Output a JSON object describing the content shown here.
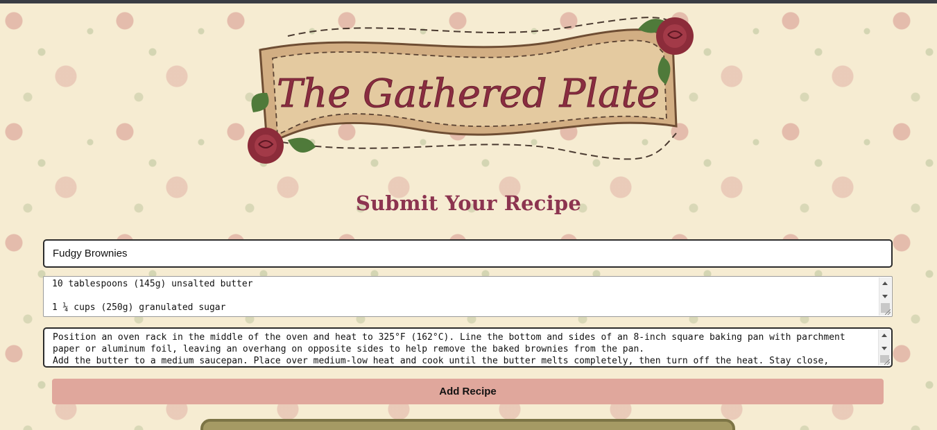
{
  "header": {
    "logo_text": "The Gathered Plate"
  },
  "page_title": "Submit Your Recipe",
  "form": {
    "recipe_name": {
      "value": "Fudgy Brownies"
    },
    "ingredients": {
      "value": "10 tablespoons (145g) unsalted butter\n\n1 ¼ cups (250g) granulated sugar"
    },
    "instructions": {
      "value": "Position an oven rack in the middle of the oven and heat to 325°F (162°C). Line the bottom and sides of an 8-inch square baking pan with parchment paper or aluminum foil, leaving an overhang on opposite sides to help remove the baked brownies from the pan.\nAdd the butter to a medium saucepan. Place over medium-low heat and cook until the butter melts completely, then turn off the heat. Stay close,"
    },
    "submit_label": "Add Recipe"
  },
  "colors": {
    "title": "#8c3450",
    "button": "#e0a79c",
    "background": "#f6ecd2",
    "panel": "#a59a64"
  }
}
